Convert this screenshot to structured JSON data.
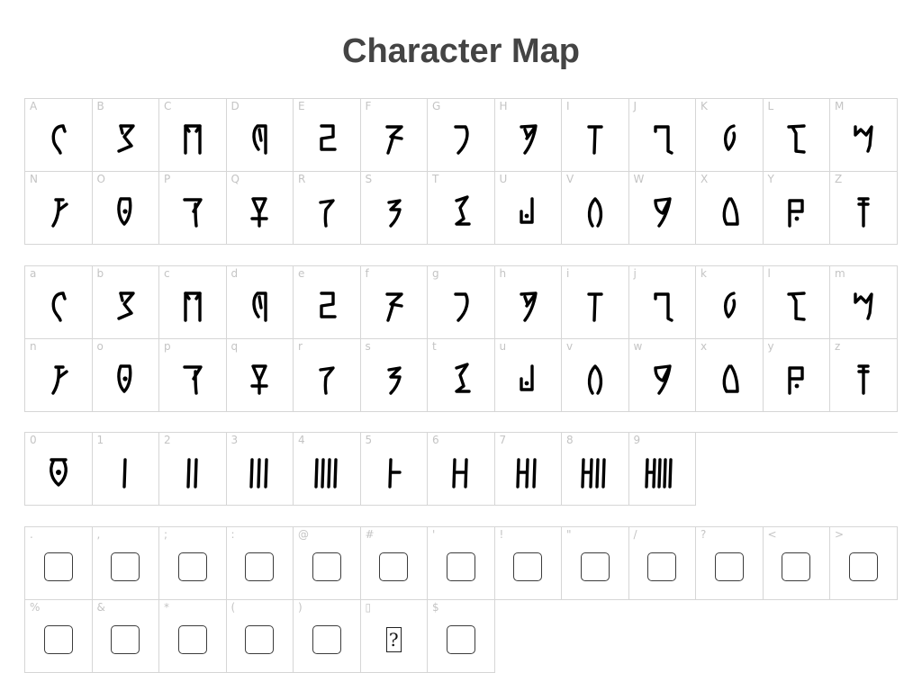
{
  "page": {
    "title": "Character Map"
  },
  "sections": [
    {
      "id": "uppercase",
      "cells": [
        {
          "label": "A",
          "glyph": "a"
        },
        {
          "label": "B",
          "glyph": "b"
        },
        {
          "label": "C",
          "glyph": "c"
        },
        {
          "label": "D",
          "glyph": "d"
        },
        {
          "label": "E",
          "glyph": "e"
        },
        {
          "label": "F",
          "glyph": "f"
        },
        {
          "label": "G",
          "glyph": "g"
        },
        {
          "label": "H",
          "glyph": "h"
        },
        {
          "label": "I",
          "glyph": "i"
        },
        {
          "label": "J",
          "glyph": "j"
        },
        {
          "label": "K",
          "glyph": "k"
        },
        {
          "label": "L",
          "glyph": "l"
        },
        {
          "label": "M",
          "glyph": "m"
        },
        {
          "label": "N",
          "glyph": "n"
        },
        {
          "label": "O",
          "glyph": "o"
        },
        {
          "label": "P",
          "glyph": "p"
        },
        {
          "label": "Q",
          "glyph": "q"
        },
        {
          "label": "R",
          "glyph": "r"
        },
        {
          "label": "S",
          "glyph": "s"
        },
        {
          "label": "T",
          "glyph": "t"
        },
        {
          "label": "U",
          "glyph": "u"
        },
        {
          "label": "V",
          "glyph": "v"
        },
        {
          "label": "W",
          "glyph": "w"
        },
        {
          "label": "X",
          "glyph": "x"
        },
        {
          "label": "Y",
          "glyph": "y"
        },
        {
          "label": "Z",
          "glyph": "z"
        }
      ]
    },
    {
      "id": "lowercase",
      "cells": [
        {
          "label": "a",
          "glyph": "a"
        },
        {
          "label": "b",
          "glyph": "b"
        },
        {
          "label": "c",
          "glyph": "c"
        },
        {
          "label": "d",
          "glyph": "d"
        },
        {
          "label": "e",
          "glyph": "e"
        },
        {
          "label": "f",
          "glyph": "f"
        },
        {
          "label": "g",
          "glyph": "g"
        },
        {
          "label": "h",
          "glyph": "h"
        },
        {
          "label": "i",
          "glyph": "i"
        },
        {
          "label": "j",
          "glyph": "j"
        },
        {
          "label": "k",
          "glyph": "k"
        },
        {
          "label": "l",
          "glyph": "l"
        },
        {
          "label": "m",
          "glyph": "m"
        },
        {
          "label": "n",
          "glyph": "n"
        },
        {
          "label": "o",
          "glyph": "o"
        },
        {
          "label": "p",
          "glyph": "p"
        },
        {
          "label": "q",
          "glyph": "q"
        },
        {
          "label": "r",
          "glyph": "r"
        },
        {
          "label": "s",
          "glyph": "s"
        },
        {
          "label": "t",
          "glyph": "t"
        },
        {
          "label": "u",
          "glyph": "u"
        },
        {
          "label": "v",
          "glyph": "v"
        },
        {
          "label": "w",
          "glyph": "w"
        },
        {
          "label": "x",
          "glyph": "x"
        },
        {
          "label": "y",
          "glyph": "y"
        },
        {
          "label": "z",
          "glyph": "z"
        }
      ]
    },
    {
      "id": "digits",
      "cells": [
        {
          "label": "0",
          "glyph": "d0"
        },
        {
          "label": "1",
          "glyph": "d1"
        },
        {
          "label": "2",
          "glyph": "d2"
        },
        {
          "label": "3",
          "glyph": "d3"
        },
        {
          "label": "4",
          "glyph": "d4"
        },
        {
          "label": "5",
          "glyph": "d5"
        },
        {
          "label": "6",
          "glyph": "d6"
        },
        {
          "label": "7",
          "glyph": "d7"
        },
        {
          "label": "8",
          "glyph": "d8"
        },
        {
          "label": "9",
          "glyph": "d9"
        }
      ]
    },
    {
      "id": "punctuation",
      "cells": [
        {
          "label": ".",
          "glyph": "missing"
        },
        {
          "label": ",",
          "glyph": "missing"
        },
        {
          "label": ";",
          "glyph": "missing"
        },
        {
          "label": ":",
          "glyph": "missing"
        },
        {
          "label": "@",
          "glyph": "missing"
        },
        {
          "label": "#",
          "glyph": "missing"
        },
        {
          "label": "'",
          "glyph": "missing"
        },
        {
          "label": "!",
          "glyph": "missing"
        },
        {
          "label": "\"",
          "glyph": "missing"
        },
        {
          "label": "/",
          "glyph": "missing"
        },
        {
          "label": "?",
          "glyph": "missing"
        },
        {
          "label": "<",
          "glyph": "missing"
        },
        {
          "label": ">",
          "glyph": "missing"
        },
        {
          "label": "%",
          "glyph": "missing"
        },
        {
          "label": "&",
          "glyph": "missing"
        },
        {
          "label": "*",
          "glyph": "missing"
        },
        {
          "label": "(",
          "glyph": "missing"
        },
        {
          "label": ")",
          "glyph": "missing"
        },
        {
          "label": "▯",
          "glyph": "unknown",
          "glyph_text": "?"
        },
        {
          "label": "$",
          "glyph": "missing"
        }
      ]
    }
  ]
}
